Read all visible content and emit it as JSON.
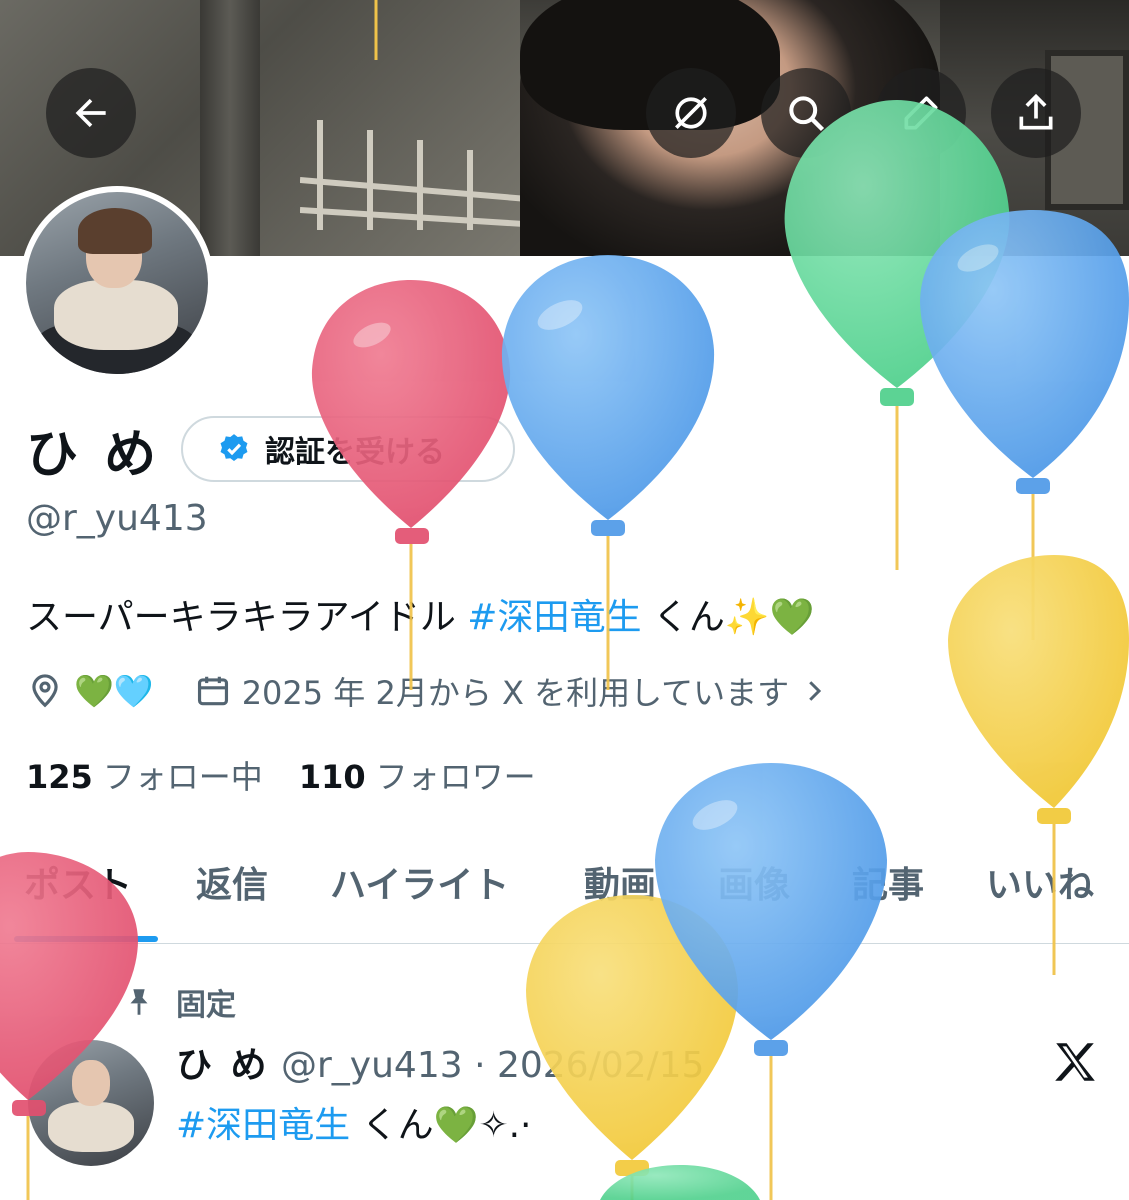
{
  "header": {
    "back_icon": "arrow-left-icon",
    "actions": [
      "grok-icon",
      "search-icon",
      "edit-icon",
      "share-icon"
    ]
  },
  "profile": {
    "name": "ひ め",
    "verify_label": "認証を受ける",
    "handle": "@r_yu413",
    "bio_prefix": "スーパーキラキラアイドル ",
    "bio_tag": "#深田竜生",
    "bio_suffix": " くん✨💚",
    "location": "💚🩵",
    "joined": "2025 年 2月から X を利用しています"
  },
  "stats": {
    "following_count": "125",
    "following_label": "フォロー中",
    "followers_count": "110",
    "followers_label": "フォロワー"
  },
  "tabs": [
    {
      "label": "ポスト",
      "active": true
    },
    {
      "label": "返信",
      "active": false
    },
    {
      "label": "ハイライト",
      "active": false
    },
    {
      "label": "動画",
      "active": false
    },
    {
      "label": "画像",
      "active": false
    },
    {
      "label": "記事",
      "active": false
    },
    {
      "label": "いいね",
      "active": false
    }
  ],
  "pinned_post": {
    "pinned_label": "固定",
    "name": "ひ め",
    "handle_date": " @r_yu413 · 2026/02/15",
    "tag": "#深田竜生",
    "text": " くん💚✧.·"
  },
  "colors": {
    "accent": "#1d9bf0",
    "text": "#0f1419",
    "muted": "#536471",
    "balloon_red": "#e2506f",
    "balloon_blue": "#5aa6ee",
    "balloon_green": "#5fd89a",
    "balloon_yellow": "#f4cf4a"
  }
}
